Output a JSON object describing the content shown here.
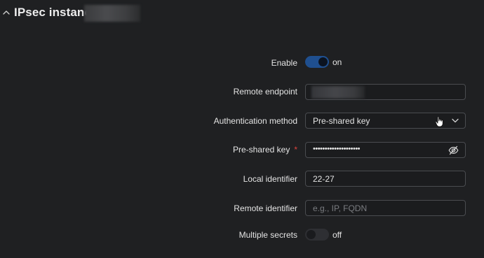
{
  "section": {
    "title": "IPsec instance:"
  },
  "form": {
    "enable": {
      "label": "Enable",
      "state": "on"
    },
    "remote_endpoint": {
      "label": "Remote endpoint"
    },
    "auth_method": {
      "label": "Authentication method",
      "value": "Pre-shared key"
    },
    "psk": {
      "label": "Pre-shared key",
      "required_mark": "*",
      "value": "••••••••••••••••••••"
    },
    "local_id": {
      "label": "Local identifier",
      "value": "22-27"
    },
    "remote_id": {
      "label": "Remote identifier",
      "placeholder": "e.g., IP, FQDN"
    },
    "multiple_secrets": {
      "label": "Multiple secrets",
      "state": "off"
    }
  },
  "colors": {
    "background": "#1f2022",
    "toggle_on": "#1f4f8f",
    "required": "#e0443e"
  },
  "icons": {
    "collapse": "chevron-up-icon",
    "select": "chevron-down-icon",
    "password": "eye-slash-icon",
    "pointer": "hand-cursor-icon"
  }
}
